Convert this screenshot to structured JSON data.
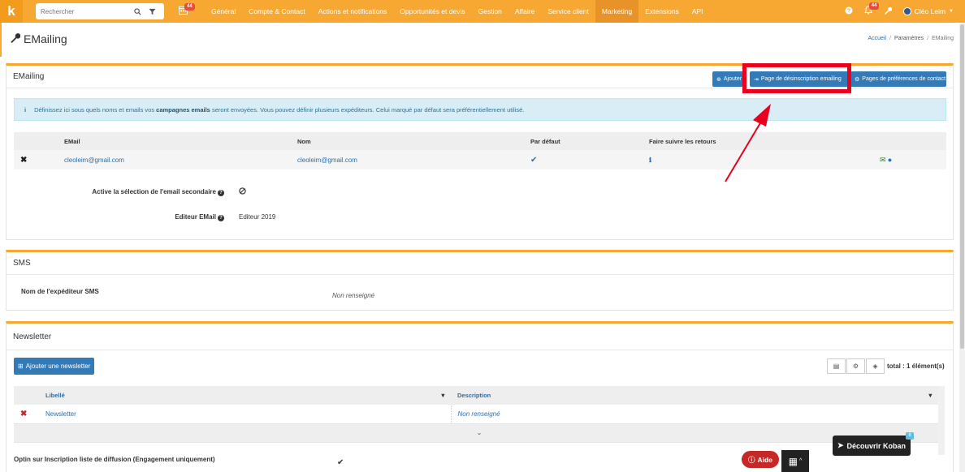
{
  "nav": {
    "logo": "k",
    "search_placeholder": "Rechercher",
    "calendar_badge": "44",
    "items": [
      {
        "label": "Général"
      },
      {
        "label": "Compte & Contact"
      },
      {
        "label": "Actions et notifications"
      },
      {
        "label": "Opportunités et devis"
      },
      {
        "label": "Gestion"
      },
      {
        "label": "Affaire"
      },
      {
        "label": "Service client"
      },
      {
        "label": "Marketing"
      },
      {
        "label": "Extensions"
      },
      {
        "label": "API"
      }
    ],
    "active_item": "Marketing",
    "notif_badge": "44",
    "user_name": "Cléo Leim"
  },
  "header": {
    "title": "EMailing",
    "breadcrumb": [
      "Accueil",
      "Paramètres",
      "EMailing"
    ]
  },
  "emailing": {
    "title": "EMailing",
    "btn_add": "Ajouter",
    "btn_unsub": "Page de désinscription emailing",
    "btn_prefs": "Pages de préférences de contact",
    "info_pre": "Définissez ici sous quels noms et emails vos ",
    "info_bold": "campagnes emails",
    "info_post": " seront envoyées. Vous pouvez définir plusieurs expéditeurs. Celui marqué par défaut sera préférentiellement utilisé.",
    "columns": [
      "EMail",
      "Nom",
      "Par défaut",
      "Faire suivre les retours"
    ],
    "rows": [
      {
        "email": "cleoleim@gmail.com",
        "nom": "cleoleim@gmail.com"
      }
    ],
    "secondary_label": "Active la sélection de l'email secondaire",
    "editor_label": "Editeur EMail",
    "editor_value": "Editeur 2019"
  },
  "sms": {
    "title": "SMS",
    "sender_label": "Nom de l'expéditeur SMS",
    "sender_value": "Non renseigné"
  },
  "newsletter": {
    "title": "Newsletter",
    "add_btn": "Ajouter une newsletter",
    "total": "total : 1 élément(s)",
    "columns": [
      "Libellé",
      "Description"
    ],
    "rows": [
      {
        "libelle": "Newsletter",
        "description": "Non renseigné"
      }
    ],
    "optin_label": "Optin sur Inscription liste de diffusion (Engagement uniquement)"
  },
  "floating": {
    "decouvrir": "Découvrir Koban",
    "decouvrir_badge": "8",
    "aide": "Aide"
  },
  "colors": {
    "brand": "#f7a832",
    "primary": "#337ab7",
    "annotation": "#e8001c"
  }
}
